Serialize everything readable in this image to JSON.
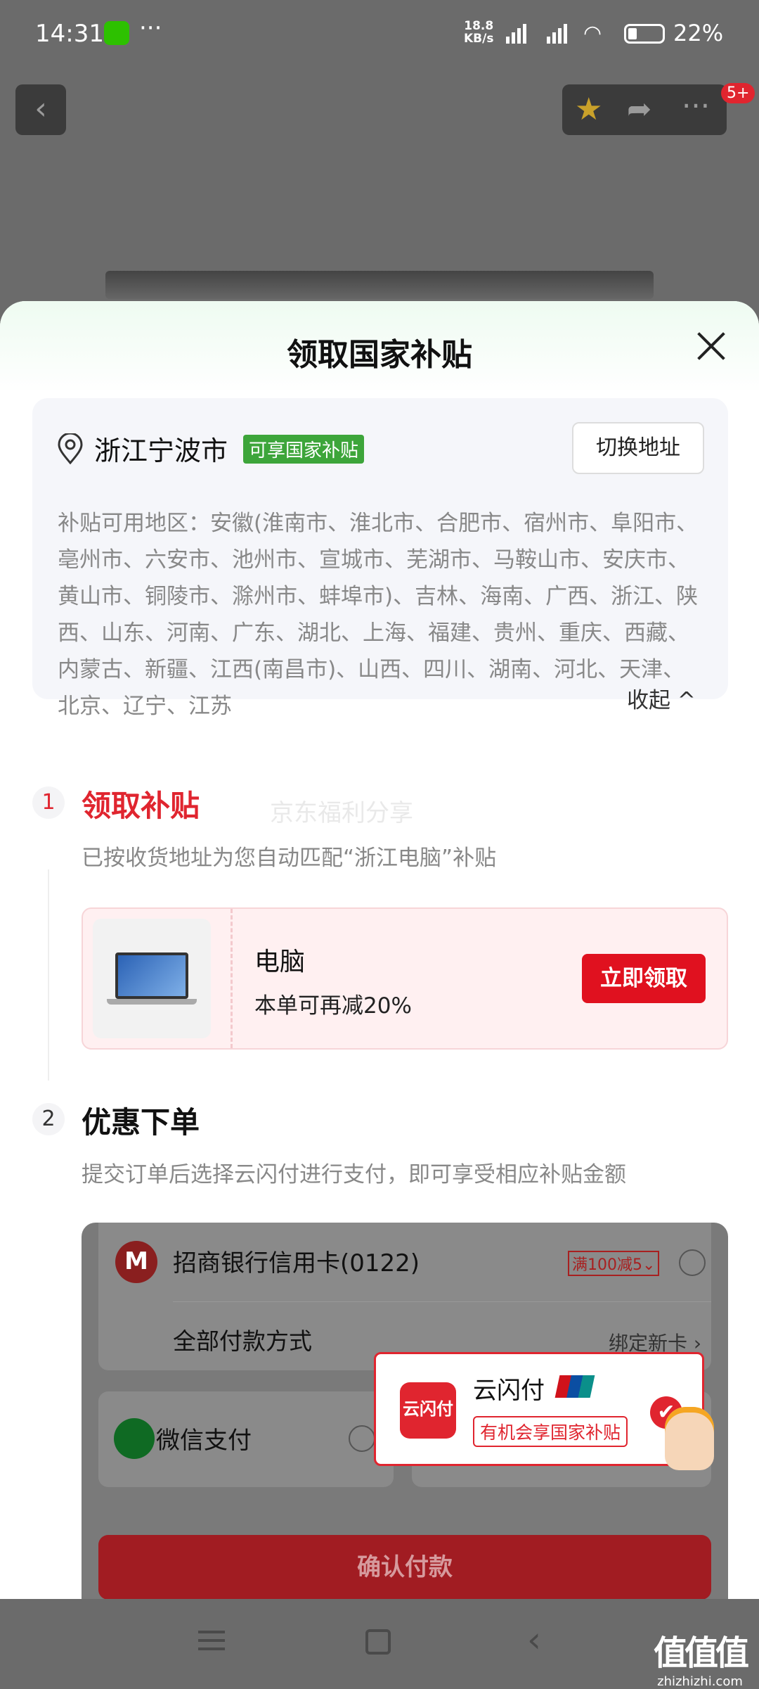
{
  "status": {
    "time": "14:31",
    "more": "···",
    "speed": "18.8\nKB/s",
    "battery": "22%"
  },
  "topnav": {
    "badge": "5+"
  },
  "sheet": {
    "title": "领取国家补贴"
  },
  "address": {
    "city": "浙江宁波市",
    "tag": "可享国家补贴",
    "switch_label": "切换地址",
    "regions": "补贴可用地区：安徽(淮南市、淮北市、合肥市、宿州市、阜阳市、亳州市、六安市、池州市、宣城市、芜湖市、马鞍山市、安庆市、黄山市、铜陵市、滁州市、蚌埠市)、吉林、海南、广西、浙江、陕西、山东、河南、广东、湖北、上海、福建、贵州、重庆、西藏、内蒙古、新疆、江西(南昌市)、山西、四川、湖南、河北、天津、北京、辽宁、江苏",
    "collapse_label": "收起 ^"
  },
  "step1": {
    "num": "1",
    "title": "领取补贴",
    "desc": "已按收货地址为您自动匹配“浙江电脑”补贴",
    "watermark": "京东福利分享"
  },
  "coupon": {
    "name": "电脑",
    "desc": "本单可再减20%",
    "claim_label": "立即领取"
  },
  "step2": {
    "num": "2",
    "title": "优惠下单",
    "desc": "提交订单后选择云闪付进行支付，即可享受相应补贴金额"
  },
  "payment": {
    "bank_logo": "M",
    "bank_name": "招商银行信用卡(0122)",
    "bank_promo": "满100减5⌄",
    "all_methods": "全部付款方式",
    "bind_new": "绑定新卡 ›",
    "wechat": "微信支付",
    "confirm": "确认付款"
  },
  "ysf_popup": {
    "logo": "云闪付",
    "name": "云闪付",
    "chance": "有机会享国家补贴",
    "check": "✔"
  },
  "watermark_logo": {
    "big": "值值值",
    "small": "zhizhizhi.com"
  }
}
